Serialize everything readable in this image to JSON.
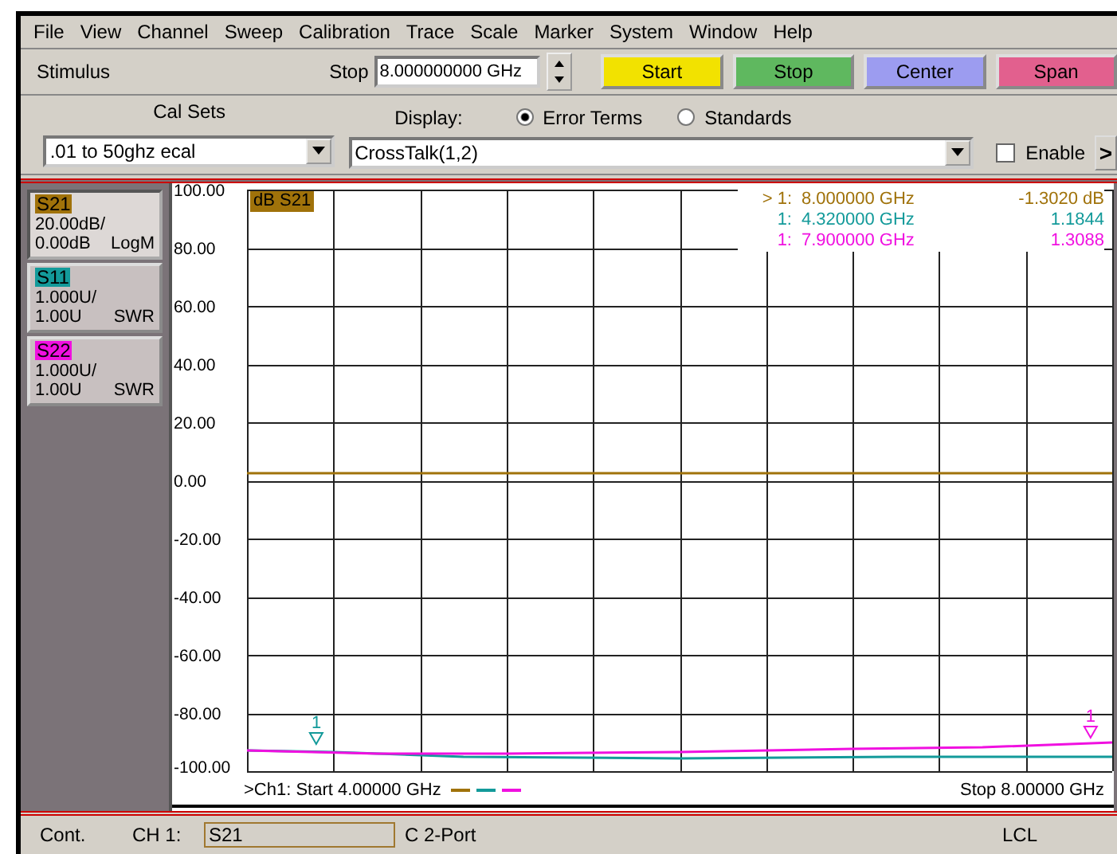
{
  "menu": [
    "File",
    "View",
    "Channel",
    "Sweep",
    "Calibration",
    "Trace",
    "Scale",
    "Marker",
    "System",
    "Window",
    "Help"
  ],
  "stimulus": {
    "label": "Stimulus",
    "field_label": "Stop",
    "value": "8.000000000 GHz",
    "buttons": [
      {
        "label": "Start",
        "color": "#f2e200"
      },
      {
        "label": "Stop",
        "color": "#5fb85f"
      },
      {
        "label": "Center",
        "color": "#9c9cf0"
      },
      {
        "label": "Span",
        "color": "#e2608e"
      }
    ]
  },
  "cal": {
    "label": "Cal Sets",
    "value": ".01 to 50ghz ecal"
  },
  "display": {
    "label": "Display:",
    "options": [
      {
        "label": "Error Terms",
        "selected": true
      },
      {
        "label": "Standards",
        "selected": false
      }
    ],
    "value": "CrossTalk(1,2)",
    "enable": {
      "label": "Enable",
      "checked": false
    },
    "more": ">"
  },
  "traces": [
    {
      "name": "S21",
      "color": "#a0720a",
      "scale": "20.00dB/",
      "ref": "0.00dB",
      "format": "LogM",
      "selected": true
    },
    {
      "name": "S11",
      "color": "#139a9a",
      "scale": "1.000U/",
      "ref": "1.00U",
      "format": "SWR",
      "selected": false
    },
    {
      "name": "S22",
      "color": "#f010e0",
      "scale": "1.000U/",
      "ref": "1.00U",
      "format": "SWR",
      "selected": false
    }
  ],
  "plot": {
    "trace_label": "dB S21",
    "readouts": [
      {
        "prefix": "> 1:",
        "stimulus": "8.000000 GHz",
        "response": "-1.3020 dB"
      },
      {
        "prefix": "1:",
        "stimulus": "4.320000 GHz",
        "response": "1.1844"
      },
      {
        "prefix": "1:",
        "stimulus": "7.900000 GHz",
        "response": "1.3088"
      }
    ],
    "marker_labels": [
      "1",
      "1"
    ],
    "start": ">Ch1: Start  4.00000 GHz",
    "stop": "Stop  8.00000 GHz",
    "y_labels": [
      "100.00",
      "80.00",
      "60.00",
      "40.00",
      "20.00",
      "0.00",
      "-20.00",
      "-40.00",
      "-60.00",
      "-80.00",
      "-100.00"
    ]
  },
  "status": {
    "mode": "Cont.",
    "channel": "CH 1:",
    "trace": "S21",
    "cal": "C  2-Port",
    "remote": "LCL"
  }
}
